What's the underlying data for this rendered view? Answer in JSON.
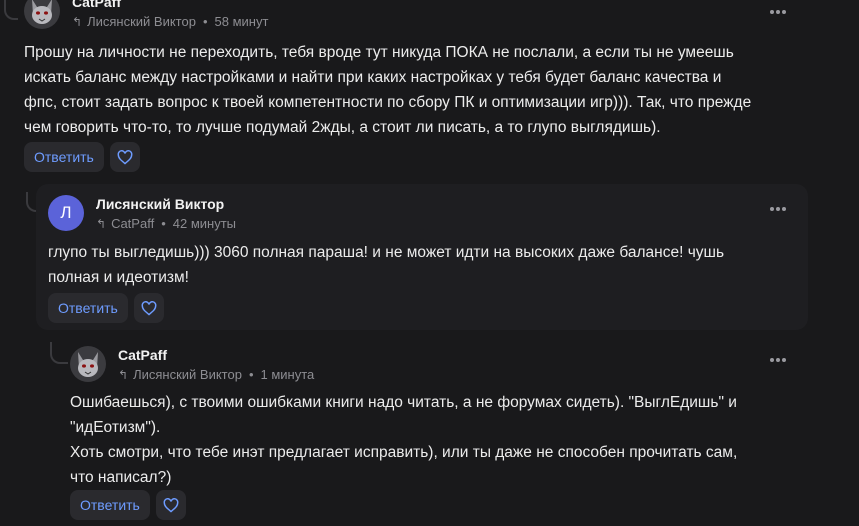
{
  "comments": [
    {
      "author": "CatPaff",
      "reply_to": "Лисянский Виктор",
      "time": "58 минут",
      "text": "Прошу на личности не переходить, тебя вроде тут никуда ПОКА не послали, а если ты не умеешь\nискать баланс между настройками и найти при каких настройках у тебя будет баланс качества и\nфпс, стоит задать вопрос к твоей компетентности по сбору ПК и оптимизации игр))). Так, что прежде\nчем говорить что-то, то лучше подумай 2жды, а стоит ли писать, а то глупо выглядишь).",
      "reply_label": "Ответить",
      "avatar_icon": "cat-avatar"
    },
    {
      "author": "Лисянский Виктор",
      "avatar_letter": "Л",
      "reply_to": "CatPaff",
      "time": "42 минуты",
      "text": "глупо ты выгледишь))) 3060 полная параша! и не может идти на высоких даже балансе! чушь\nполная и идеотизм!",
      "reply_label": "Ответить"
    },
    {
      "author": "CatPaff",
      "reply_to": "Лисянский Виктор",
      "time": "1 минута",
      "text": "Ошибаешься), с твоими ошибками книги надо читать, а не форумах сидеть). \"ВыглЕдишь\" и\n\"идЕотизм\").\nХоть смотри, что тебе инэт предлагает исправить), или ты даже не способен прочитать сам,\nчто написал?)",
      "reply_label": "Ответить",
      "avatar_icon": "cat-avatar"
    }
  ],
  "colors": {
    "background": "#19191b",
    "accent": "#6e9cff",
    "avatar_letter_bg": "#5b63d9",
    "muted": "#8d8d92"
  },
  "icons": {
    "reply": "reply-arrow-icon",
    "more": "more-dots-icon",
    "like": "heart-icon"
  }
}
